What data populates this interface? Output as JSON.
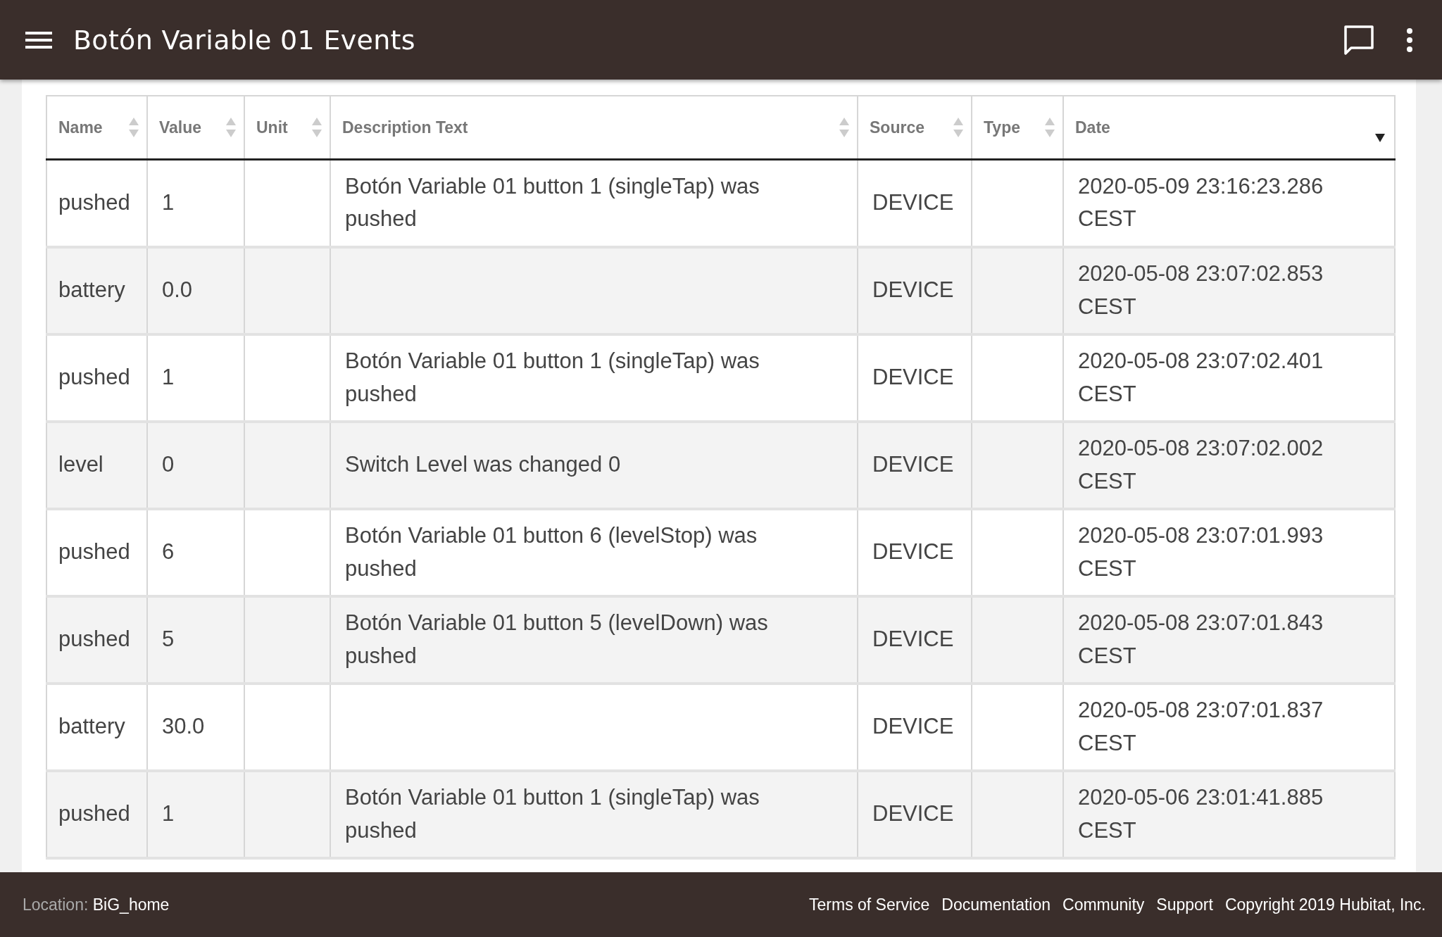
{
  "header": {
    "title": "Botón Variable 01 Events"
  },
  "table": {
    "columns": [
      {
        "label": "Name",
        "sorted_descending": false
      },
      {
        "label": "Value",
        "sorted_descending": false
      },
      {
        "label": "Unit",
        "sorted_descending": false
      },
      {
        "label": "Description Text",
        "sorted_descending": false
      },
      {
        "label": "Source",
        "sorted_descending": false
      },
      {
        "label": "Type",
        "sorted_descending": false
      },
      {
        "label": "Date",
        "sorted_descending": true
      }
    ],
    "rows": [
      {
        "name": "pushed",
        "value": "1",
        "description": "Botón Variable 01 button 1 (singleTap) was pushed",
        "source": "DEVICE",
        "date": "2020-05-09 23:16:23.286 CEST"
      },
      {
        "name": "battery",
        "value": "0.0",
        "source": "DEVICE",
        "date": "2020-05-08 23:07:02.853 CEST"
      },
      {
        "name": "pushed",
        "value": "1",
        "description": "Botón Variable 01 button 1 (singleTap) was pushed",
        "source": "DEVICE",
        "date": "2020-05-08 23:07:02.401 CEST"
      },
      {
        "name": "level",
        "value": "0",
        "description": "Switch Level was changed 0",
        "source": "DEVICE",
        "date": "2020-05-08 23:07:02.002 CEST"
      },
      {
        "name": "pushed",
        "value": "6",
        "description": "Botón Variable 01 button 6 (levelStop) was pushed",
        "source": "DEVICE",
        "date": "2020-05-08 23:07:01.993 CEST"
      },
      {
        "name": "pushed",
        "value": "5",
        "description": "Botón Variable 01 button 5 (levelDown) was pushed",
        "source": "DEVICE",
        "date": "2020-05-08 23:07:01.843 CEST"
      },
      {
        "name": "battery",
        "value": "30.0",
        "source": "DEVICE",
        "date": "2020-05-08 23:07:01.837 CEST"
      },
      {
        "name": "pushed",
        "value": "1",
        "description": "Botón Variable 01 button 1 (singleTap) was pushed",
        "source": "DEVICE",
        "date": "2020-05-06 23:01:41.885 CEST"
      }
    ]
  },
  "footer": {
    "location_label": "Location:",
    "location": "BiG_home",
    "links": [
      "Terms of Service",
      "Documentation",
      "Community",
      "Support"
    ],
    "copyright": "Copyright 2019 Hubitat, Inc."
  }
}
